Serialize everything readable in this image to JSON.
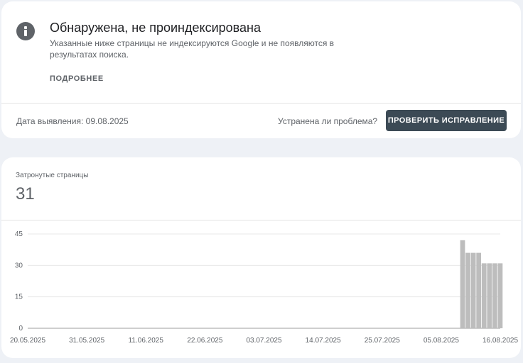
{
  "issue": {
    "title": "Обнаружена, не проиндексирована",
    "description": "Указанные ниже страницы не индексируются Google и не появляются в результатах поиска.",
    "more_label": "ПОДРОБНЕЕ",
    "detected_label": "Дата выявления: 09.08.2025",
    "question_label": "Устранена ли проблема?",
    "validate_label": "ПРОВЕРИТЬ ИСПРАВЛЕНИЕ",
    "icon": "info-icon"
  },
  "affected": {
    "label": "Затронутые страницы",
    "count": "31"
  },
  "chart_data": {
    "type": "bar",
    "title": "",
    "xlabel": "",
    "ylabel": "",
    "ylim": [
      0,
      45
    ],
    "y_ticks": [
      0,
      15,
      30,
      45
    ],
    "x_start": "20.05.2025",
    "x_end": "16.08.2025",
    "x_tick_labels": [
      "20.05.2025",
      "31.05.2025",
      "11.06.2025",
      "22.06.2025",
      "03.07.2025",
      "14.07.2025",
      "25.07.2025",
      "05.08.2025",
      "16.08.2025"
    ],
    "bar_color": "#bdbdbd",
    "points": [
      {
        "date": "09.08.2025",
        "value": 42
      },
      {
        "date": "10.08.2025",
        "value": 36
      },
      {
        "date": "11.08.2025",
        "value": 36
      },
      {
        "date": "12.08.2025",
        "value": 36
      },
      {
        "date": "13.08.2025",
        "value": 31
      },
      {
        "date": "14.08.2025",
        "value": 31
      },
      {
        "date": "15.08.2025",
        "value": 31
      },
      {
        "date": "16.08.2025",
        "value": 31
      }
    ]
  }
}
